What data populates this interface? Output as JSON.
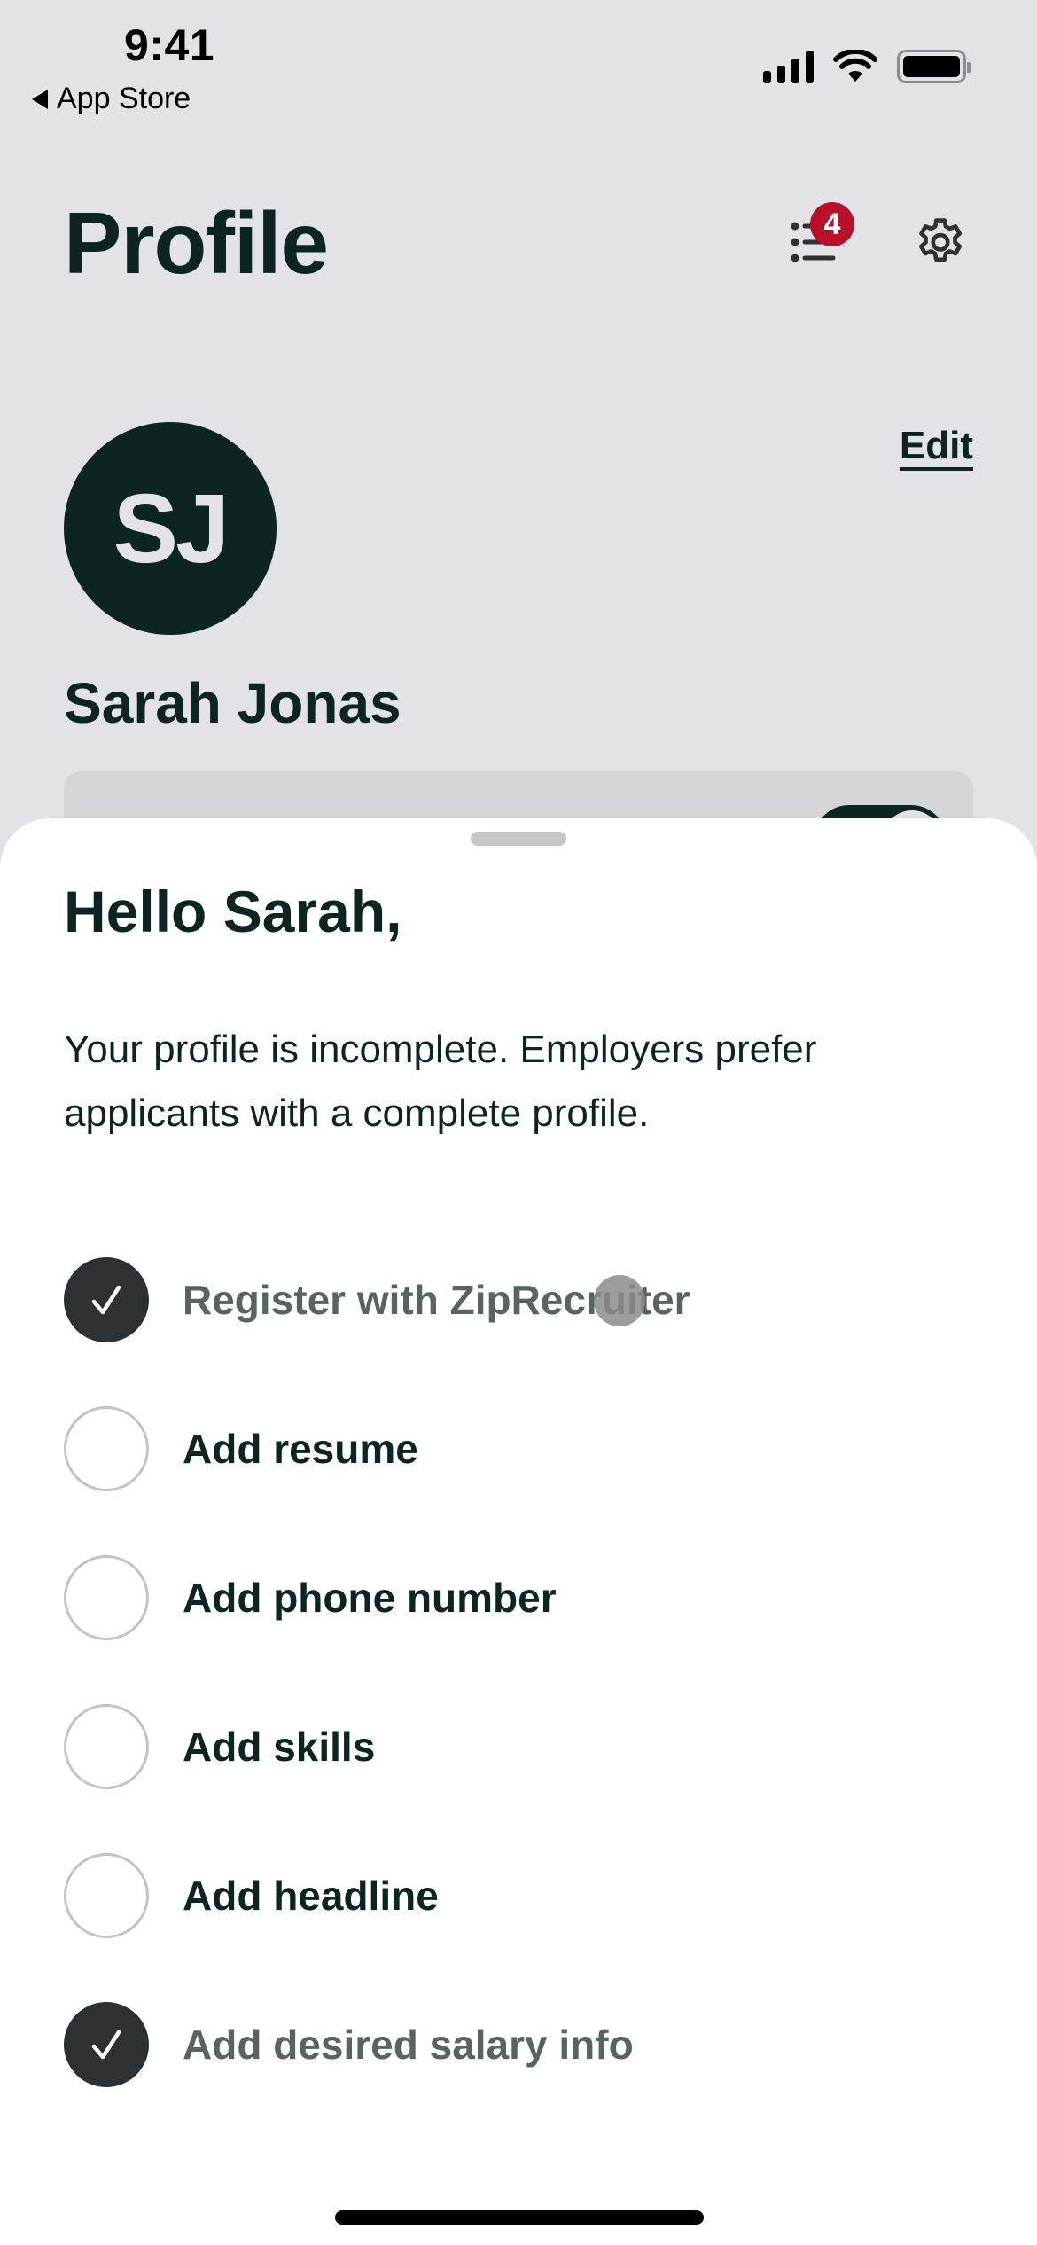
{
  "status_bar": {
    "time": "9:41",
    "back_label": "App Store",
    "icons": [
      "cellular-signal-icon",
      "wifi-icon",
      "battery-icon"
    ]
  },
  "header": {
    "title": "Profile",
    "notifications_icon": "list-bullets-icon",
    "notifications_count": "4",
    "settings_icon": "gear-icon",
    "badge_color": "#b80f2a"
  },
  "profile": {
    "initials": "SJ",
    "name": "Sarah Jonas",
    "edit_label": "Edit"
  },
  "sheet": {
    "title": "Hello Sarah,",
    "description": "Your profile is incomplete. Employers prefer applicants with a complete profile.",
    "items": [
      {
        "label": "Register with ZipRecruiter",
        "completed": true
      },
      {
        "label": "Add resume",
        "completed": false
      },
      {
        "label": "Add phone number",
        "completed": false
      },
      {
        "label": "Add skills",
        "completed": false
      },
      {
        "label": "Add headline",
        "completed": false
      },
      {
        "label": "Add desired salary info",
        "completed": true
      }
    ]
  },
  "colors": {
    "primary_dark": "#0c2523",
    "background": "#e3e2e6",
    "completed_text": "#586462",
    "check_fill": "#2e3133"
  }
}
